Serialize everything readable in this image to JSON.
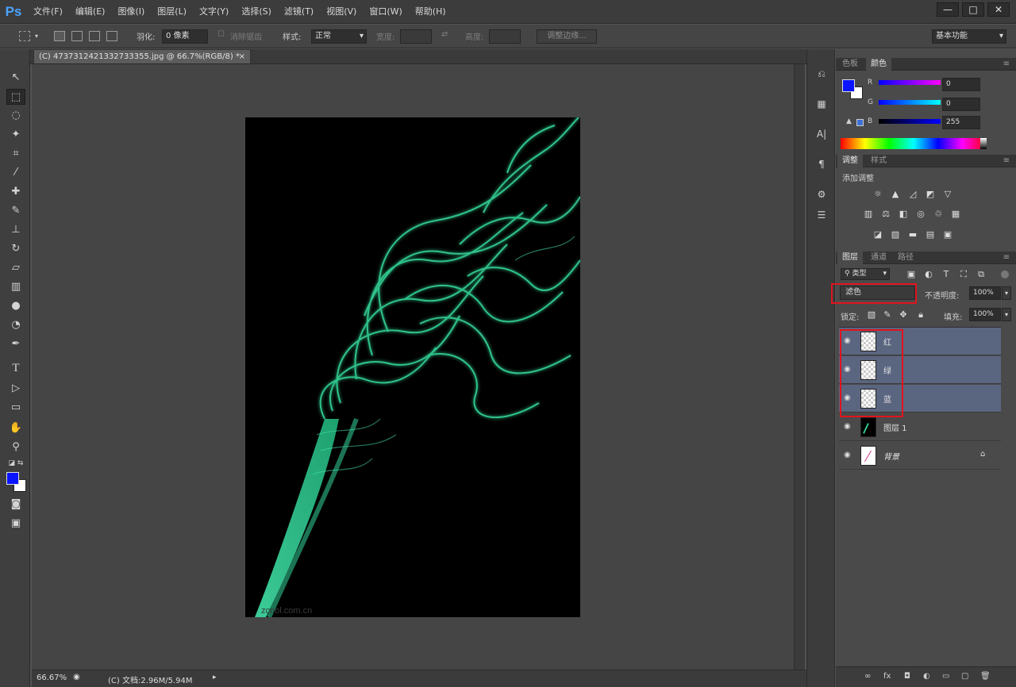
{
  "app": {
    "logo": "Ps"
  },
  "menu": [
    "文件(F)",
    "编辑(E)",
    "图像(I)",
    "图层(L)",
    "文字(Y)",
    "选择(S)",
    "滤镜(T)",
    "视图(V)",
    "窗口(W)",
    "帮助(H)"
  ],
  "window_controls": [
    "—",
    "□",
    "✕"
  ],
  "options": {
    "feather_label": "羽化:",
    "feather_value": "0 像素",
    "antialias_label": "消除锯齿",
    "style_label": "样式:",
    "style_value": "正常",
    "width_label": "宽度:",
    "height_label": "高度:",
    "refine_edge_label": "调整边缘...",
    "workspace_value": "基本功能"
  },
  "document": {
    "tab_title": "(C) 4737312421332733355.jpg @ 66.7%(RGB/8) *",
    "watermark": "zcool.com.cn"
  },
  "status": {
    "zoom": "66.67%",
    "doc_info": "(C) 文档:2.96M/5.94M"
  },
  "color_panel": {
    "tabs": [
      "色板",
      "颜色"
    ],
    "channels": [
      {
        "label": "R",
        "value": "0"
      },
      {
        "label": "G",
        "value": "0"
      },
      {
        "label": "B",
        "value": "255"
      }
    ],
    "fg_color": "#0a14ff",
    "bg_color": "#ffffff"
  },
  "adjust_panel": {
    "tabs": [
      "调整",
      "样式"
    ],
    "add_label": "添加调整",
    "icons": [
      "brightness-icon",
      "levels-icon",
      "curves-icon",
      "exposure-icon",
      "vibrance-icon",
      "hue-saturation-icon",
      "color-balance-icon",
      "black-white-icon",
      "photo-filter-icon",
      "channel-mixer-icon",
      "color-lookup-icon",
      "invert-icon",
      "posterize-icon",
      "threshold-icon",
      "gradient-map-icon",
      "selective-color-icon"
    ]
  },
  "layers_panel": {
    "tabs": [
      "图层",
      "通道",
      "路径"
    ],
    "filter_kind": "类型",
    "blend_mode": "滤色",
    "opacity_label": "不透明度:",
    "opacity_value": "100%",
    "lock_label": "锁定:",
    "fill_label": "填充:",
    "fill_value": "100%",
    "layers": [
      {
        "name": "红",
        "selected": true
      },
      {
        "name": "绿",
        "selected": true
      },
      {
        "name": "蓝",
        "selected": true
      },
      {
        "name": "图层 1",
        "selected": false
      },
      {
        "name": "背景",
        "selected": false
      }
    ]
  }
}
